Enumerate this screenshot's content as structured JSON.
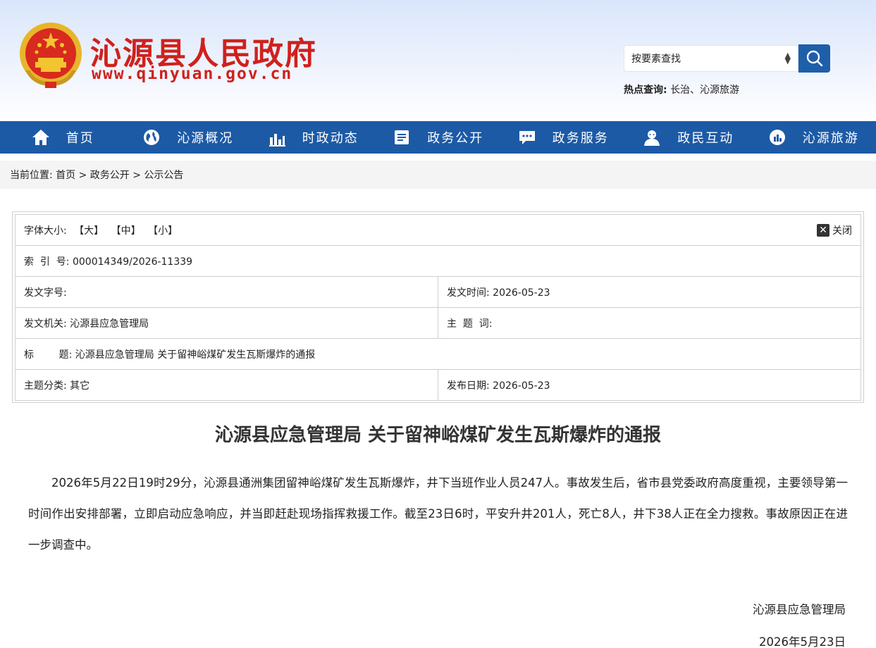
{
  "header": {
    "site_name": "沁源县人民政府",
    "site_url": "www.qinyuan.gov.cn",
    "search_placeholder": "按要素查找",
    "hot_label": "热点查询:",
    "hot_links": "长治、沁源旅游"
  },
  "nav": [
    {
      "label": "首页",
      "icon": "home-icon"
    },
    {
      "label": "沁源概况",
      "icon": "globe-icon"
    },
    {
      "label": "时政动态",
      "icon": "chart-icon"
    },
    {
      "label": "政务公开",
      "icon": "document-icon"
    },
    {
      "label": "政务服务",
      "icon": "chat-icon"
    },
    {
      "label": "政民互动",
      "icon": "people-icon"
    },
    {
      "label": "沁源旅游",
      "icon": "travel-icon"
    }
  ],
  "breadcrumb": "当前位置: 首页 > 政务公开 > 公示公告",
  "info": {
    "font_size_label": "字体大小:",
    "font_large": "【大】",
    "font_medium": "【中】",
    "font_small": "【小】",
    "close_label": "关闭",
    "index_no": "索  引  号: 000014349/2026-11339",
    "doc_no": "发文字号:",
    "doc_time": "发文时间: 2026-05-23",
    "issuer": "发文机关: 沁源县应急管理局",
    "keywords": "主  题  词:",
    "title": "标        题: 沁源县应急管理局 关于留神峪煤矿发生瓦斯爆炸的通报",
    "category": "主题分类: 其它",
    "publish_date": "发布日期: 2026-05-23"
  },
  "article": {
    "title": "沁源县应急管理局 关于留神峪煤矿发生瓦斯爆炸的通报",
    "body": "2026年5月22日19时29分，沁源县通洲集团留神峪煤矿发生瓦斯爆炸，井下当班作业人员247人。事故发生后，省市县党委政府高度重视，主要领导第一时间作出安排部署，立即启动应急响应，并当即赶赴现场指挥救援工作。截至23日6时，平安升井201人，死亡8人，井下38人正在全力搜救。事故原因正在进一步调查中。",
    "signature_org": "沁源县应急管理局",
    "signature_date": "2026年5月23日"
  }
}
